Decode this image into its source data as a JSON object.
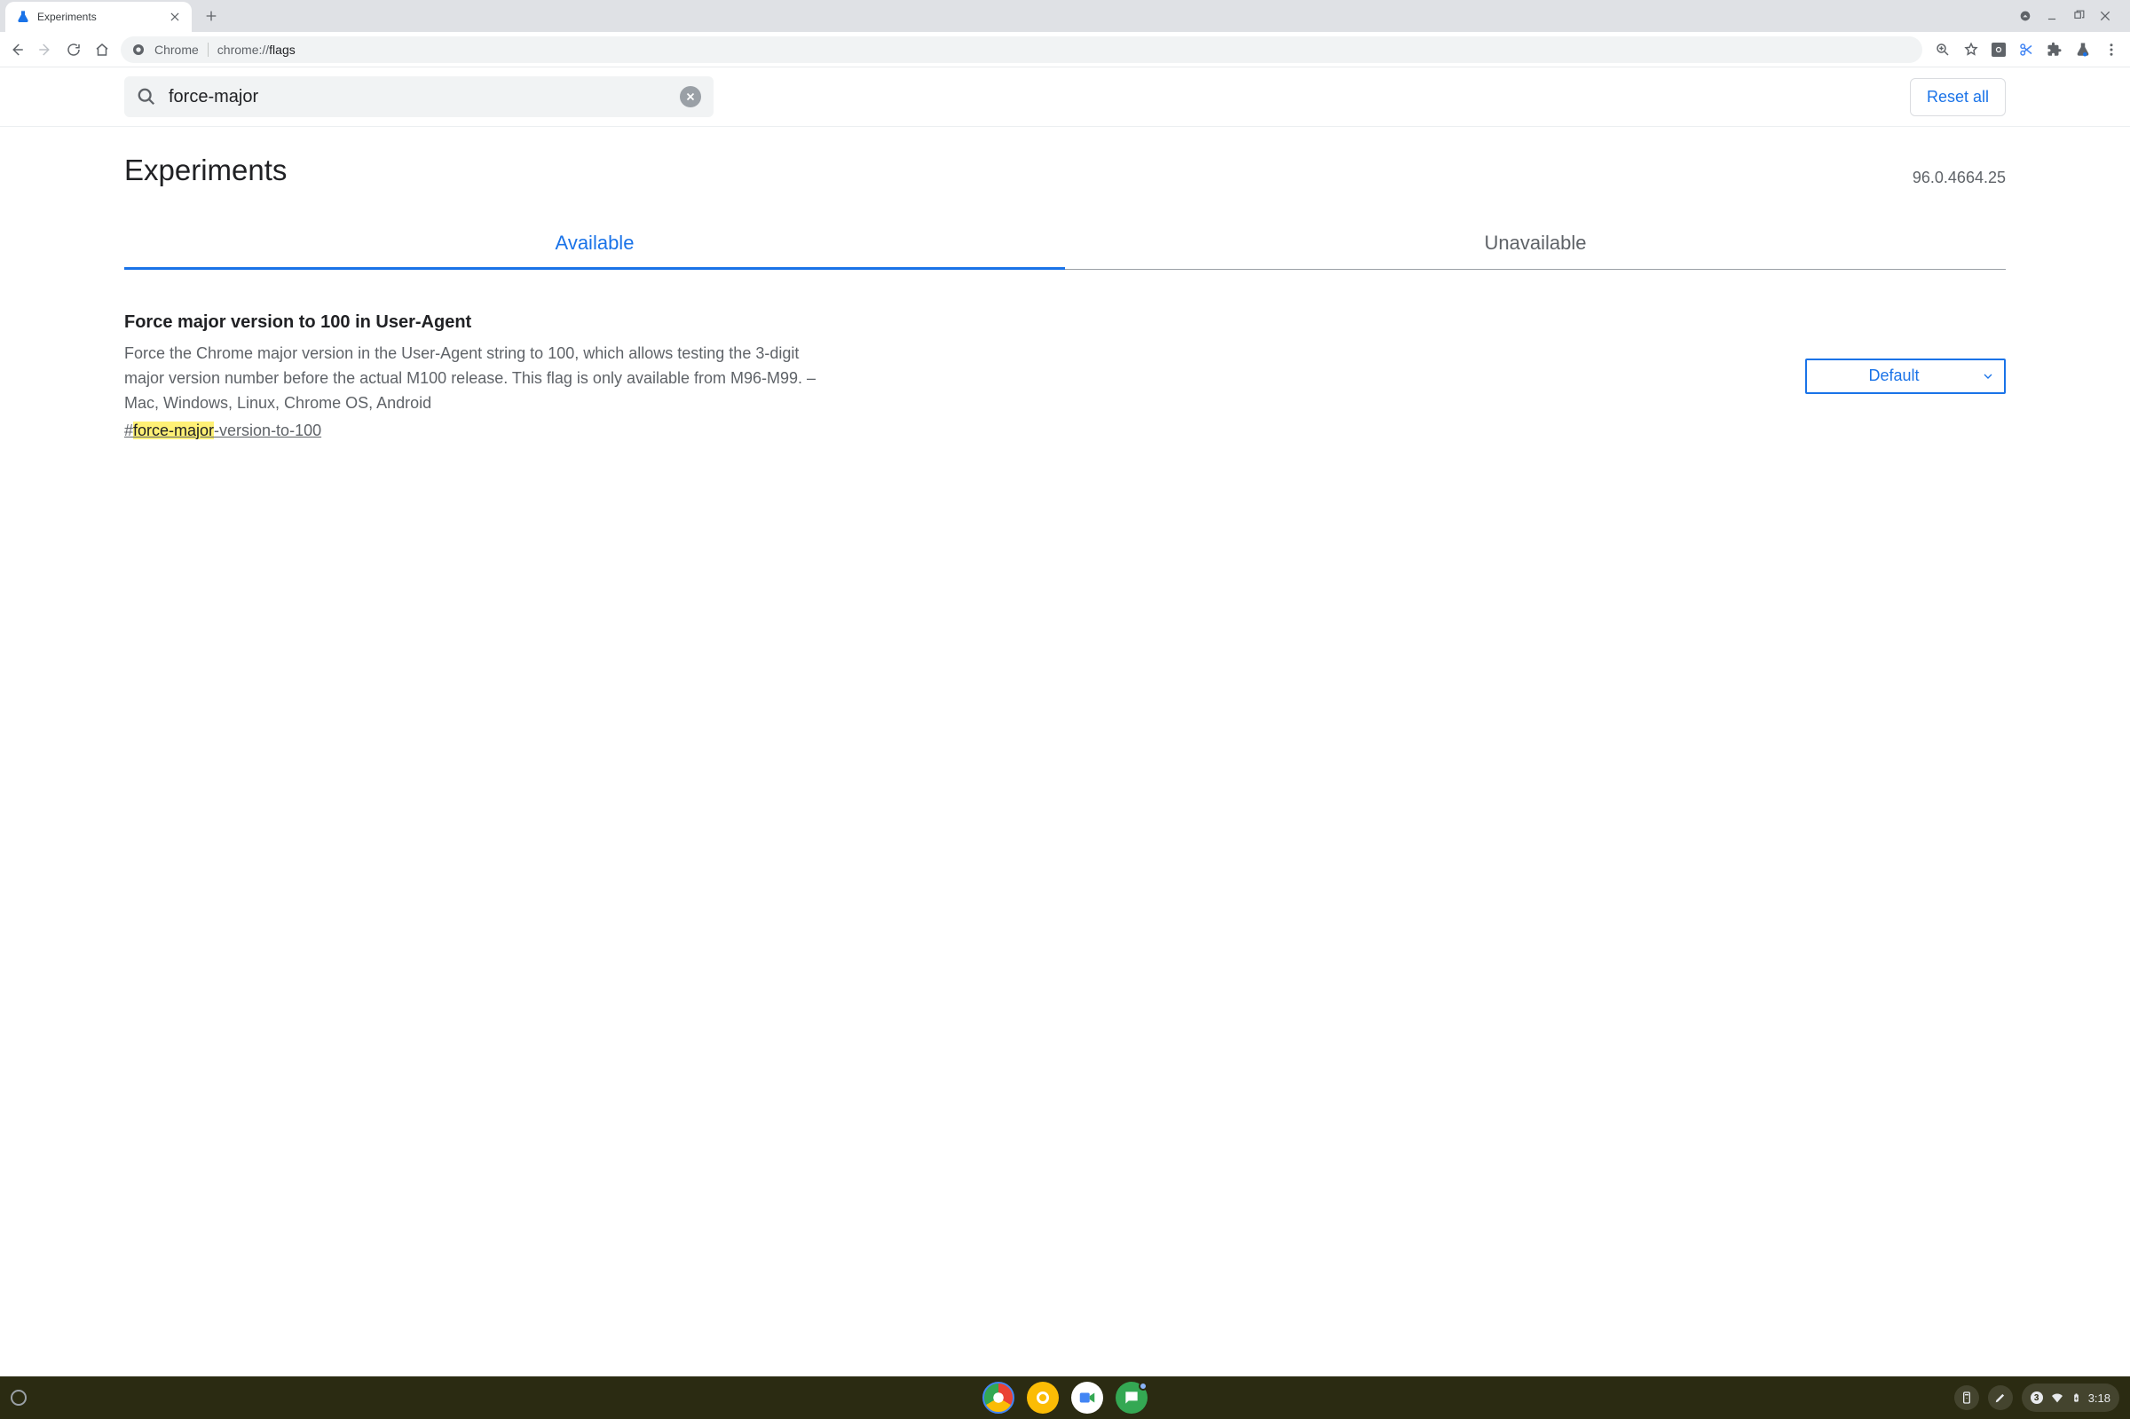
{
  "browser": {
    "tab_title": "Experiments",
    "omnibox_chip": "Chrome",
    "omnibox_prefix": "chrome://",
    "omnibox_path": "flags"
  },
  "search": {
    "value": "force-major",
    "reset_label": "Reset all"
  },
  "header": {
    "title": "Experiments",
    "version": "96.0.4664.25"
  },
  "tabs": {
    "available": "Available",
    "unavailable": "Unavailable"
  },
  "flag": {
    "title": "Force major version to 100 in User-Agent",
    "description": "Force the Chrome major version in the User-Agent string to 100, which allows testing the 3-digit major version number before the actual M100 release. This flag is only available from M96-M99. – Mac, Windows, Linux, Chrome OS, Android",
    "anchor_prefix": "#",
    "anchor_highlight": "force-major",
    "anchor_suffix": "-version-to-100",
    "select_value": "Default"
  },
  "shelf": {
    "notification_count": "3",
    "time": "3:18"
  }
}
